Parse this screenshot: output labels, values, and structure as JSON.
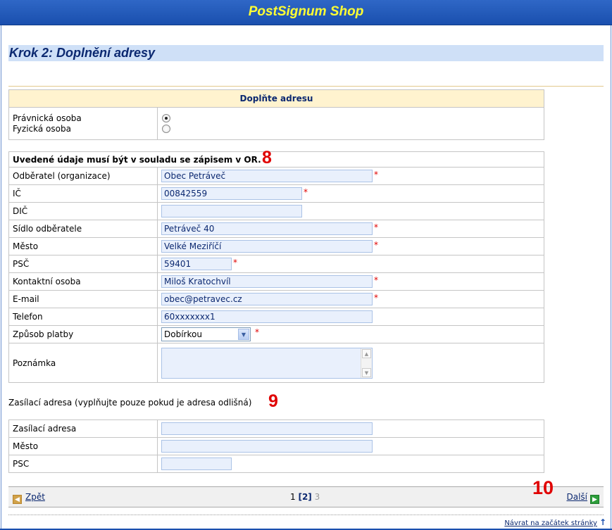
{
  "header": {
    "title": "PostSignum Shop"
  },
  "step_title": "Krok 2: Doplnění adresy",
  "section1": {
    "heading": "Doplňte adresu",
    "options": [
      "Právnická osoba",
      "Fyzická osoba"
    ],
    "selected": 0
  },
  "section2": {
    "notice": "Uvedené údaje musí být v souladu se zápisem v OR.",
    "notice_marker": "8",
    "fields": [
      {
        "label": "Odběratel (organizace)",
        "value": "Obec Petráveč",
        "required": "*"
      },
      {
        "label": "IČ",
        "value": "00842559",
        "required": "*"
      },
      {
        "label": "DIČ",
        "value": ""
      },
      {
        "label": "Sídlo odběratele",
        "value": "Petráveč 40",
        "required": "*"
      },
      {
        "label": "Město",
        "value": "Velké Meziříčí",
        "required": "*"
      },
      {
        "label": "PSČ",
        "value": "59401",
        "required": "*"
      },
      {
        "label": "Kontaktní osoba",
        "value": "Miloš Kratochvíl",
        "required": "*"
      },
      {
        "label": "E-mail",
        "value": "obec@petravec.cz",
        "required": "*"
      },
      {
        "label": "Telefon",
        "value": "60xxxxxxx1"
      },
      {
        "label": "Způsob platby",
        "value": "Dobírkou",
        "required": "*"
      },
      {
        "label": "Poznámka",
        "value": ""
      }
    ]
  },
  "section3": {
    "label": "Zasílací adresa (vyplňujte pouze pokud je adresa odlišná)",
    "marker": "9",
    "fields": [
      {
        "label": "Zasílací adresa",
        "value": ""
      },
      {
        "label": "Město",
        "value": ""
      },
      {
        "label": "PSC",
        "value": ""
      }
    ]
  },
  "navigation": {
    "back_label": "Zpět",
    "page_first": "1",
    "page_current": "[2]",
    "page_last": "3",
    "next_marker": "10",
    "next_label": "Další"
  },
  "footer": {
    "top_link": "Návrat na začátek stránky"
  }
}
